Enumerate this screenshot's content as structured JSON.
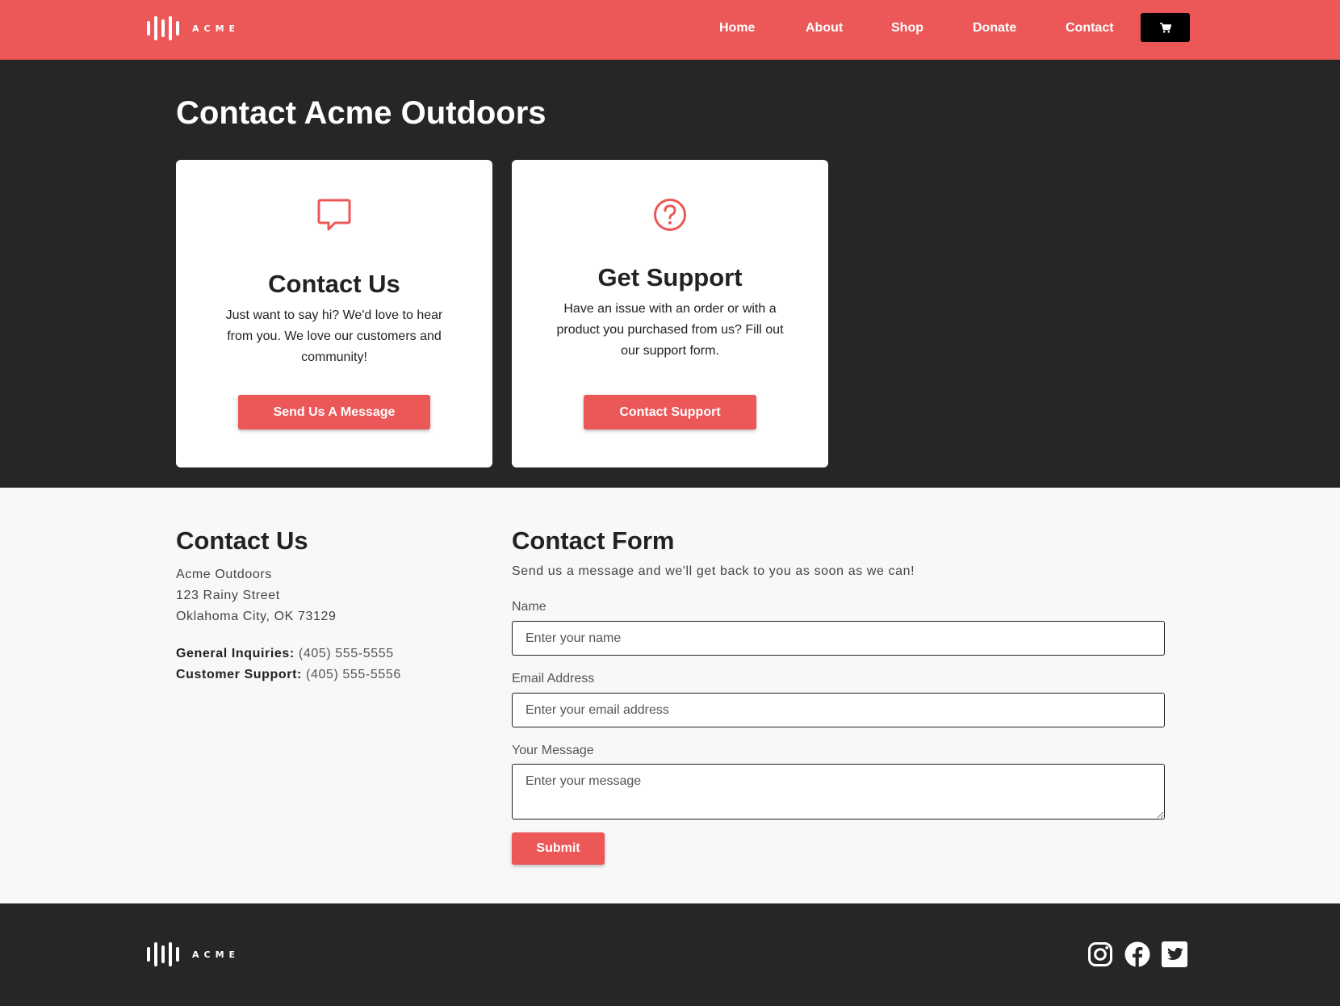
{
  "header": {
    "logo_text": "ACME",
    "nav": [
      "Home",
      "About",
      "Shop",
      "Donate",
      "Contact"
    ],
    "cart_icon": "cart-icon"
  },
  "hero": {
    "title": "Contact Acme Outdoors",
    "cards": [
      {
        "icon": "chat-bubble-icon",
        "title": "Contact Us",
        "text": "Just want to say hi? We'd love to hear from you. We love our customers and community!",
        "button": "Send Us A Message"
      },
      {
        "icon": "question-circle-icon",
        "title": "Get Support",
        "text": "Have an issue with an order or with a product you purchased from us? Fill out our support form.",
        "button": "Contact Support"
      }
    ]
  },
  "contact": {
    "title": "Contact Us",
    "address": [
      "Acme Outdoors",
      "123 Rainy Street",
      "Oklahoma City, OK 73129"
    ],
    "general_label": "General Inquiries:",
    "general_phone": "(405) 555-5555",
    "support_label": "Customer Support:",
    "support_phone": "(405) 555-5556"
  },
  "form": {
    "title": "Contact Form",
    "subtitle": "Send us a message and we'll get back to you as soon as we can!",
    "name_label": "Name",
    "name_placeholder": "Enter your name",
    "email_label": "Email Address",
    "email_placeholder": "Enter your email address",
    "message_label": "Your Message",
    "message_placeholder": "Enter your message",
    "submit": "Submit"
  },
  "footer": {
    "logo_text": "ACME",
    "social_icons": [
      "instagram-icon",
      "facebook-icon",
      "twitter-icon"
    ]
  },
  "colors": {
    "accent": "#ec5757",
    "dark": "#262626",
    "light_bg": "#f8f8f8"
  }
}
